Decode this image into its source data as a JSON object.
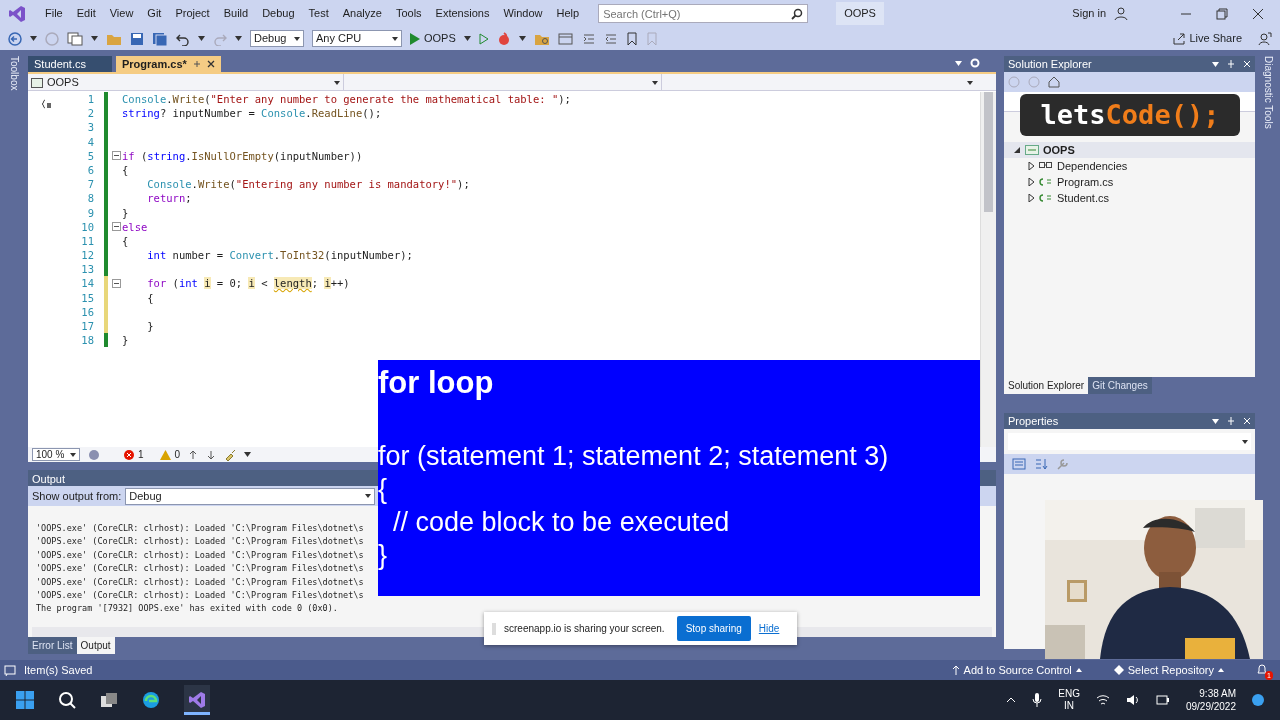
{
  "menu": [
    "File",
    "Edit",
    "View",
    "Git",
    "Project",
    "Build",
    "Debug",
    "Test",
    "Analyze",
    "Tools",
    "Extensions",
    "Window",
    "Help"
  ],
  "search": {
    "placeholder": "Search (Ctrl+Q)"
  },
  "solution_name": "OOPS",
  "sign_in": "Sign in",
  "toolbar": {
    "configuration": "Debug",
    "platform": "Any CPU",
    "run_target": "OOPS",
    "live_share": "Live Share"
  },
  "side_tabs": {
    "left": "Toolbox",
    "right": "Diagnostic Tools"
  },
  "editor": {
    "tabs": [
      {
        "label": "Student.cs",
        "selected": false
      },
      {
        "label": "Program.cs*",
        "selected": true
      }
    ],
    "project_dropdown": "OOPS",
    "lines": [
      {
        "number": "1",
        "modified": false,
        "foldable": false,
        "tokens": [
          {
            "text": "Console",
            "kind": "type"
          },
          {
            "text": ".",
            "kind": "plain"
          },
          {
            "text": "Write",
            "kind": "method"
          },
          {
            "text": "(",
            "kind": "plain"
          },
          {
            "text": "\"Enter any number to generate the mathematical table: \"",
            "kind": "string"
          },
          {
            "text": ");",
            "kind": "plain"
          }
        ]
      },
      {
        "number": "2",
        "modified": false,
        "foldable": false,
        "tokens": [
          {
            "text": "string",
            "kind": "keyword"
          },
          {
            "text": "? inputNumber = ",
            "kind": "plain"
          },
          {
            "text": "Console",
            "kind": "type"
          },
          {
            "text": ".",
            "kind": "plain"
          },
          {
            "text": "ReadLine",
            "kind": "method"
          },
          {
            "text": "();",
            "kind": "plain"
          }
        ]
      },
      {
        "number": "3",
        "modified": false,
        "foldable": false
      },
      {
        "number": "4",
        "modified": false,
        "foldable": false
      },
      {
        "number": "5",
        "modified": false,
        "foldable": true,
        "tokens": [
          {
            "text": "if",
            "kind": "control"
          },
          {
            "text": " (",
            "kind": "plain"
          },
          {
            "text": "string",
            "kind": "keyword"
          },
          {
            "text": ".",
            "kind": "plain"
          },
          {
            "text": "IsNullOrEmpty",
            "kind": "method"
          },
          {
            "text": "(inputNumber))",
            "kind": "plain"
          }
        ]
      },
      {
        "number": "6",
        "modified": false,
        "foldable": false,
        "tokens": [
          {
            "text": "{",
            "kind": "plain"
          }
        ]
      },
      {
        "number": "7",
        "modified": false,
        "foldable": false,
        "tokens": [
          {
            "text": "    Console",
            "kind": "type"
          },
          {
            "text": ".",
            "kind": "plain"
          },
          {
            "text": "Write",
            "kind": "method"
          },
          {
            "text": "(",
            "kind": "plain"
          },
          {
            "text": "\"Entering any number is mandatory!\"",
            "kind": "string"
          },
          {
            "text": ");",
            "kind": "plain"
          }
        ]
      },
      {
        "number": "8",
        "modified": false,
        "foldable": false,
        "tokens": [
          {
            "text": "    return",
            "kind": "control"
          },
          {
            "text": ";",
            "kind": "plain"
          }
        ]
      },
      {
        "number": "9",
        "modified": false,
        "foldable": false,
        "tokens": [
          {
            "text": "}",
            "kind": "plain"
          }
        ]
      },
      {
        "number": "10",
        "modified": false,
        "foldable": true,
        "tokens": [
          {
            "text": "else",
            "kind": "control"
          }
        ]
      },
      {
        "number": "11",
        "modified": false,
        "foldable": false,
        "tokens": [
          {
            "text": "{",
            "kind": "plain"
          }
        ]
      },
      {
        "number": "12",
        "modified": false,
        "foldable": false,
        "tokens": [
          {
            "text": "    int",
            "kind": "keyword"
          },
          {
            "text": " number = ",
            "kind": "plain"
          },
          {
            "text": "Convert",
            "kind": "type"
          },
          {
            "text": ".",
            "kind": "plain"
          },
          {
            "text": "ToInt32",
            "kind": "method"
          },
          {
            "text": "(inputNumber);",
            "kind": "plain"
          }
        ]
      },
      {
        "number": "13",
        "modified": false,
        "foldable": false
      },
      {
        "number": "14",
        "modified": true,
        "foldable": true,
        "tokens": [
          {
            "text": "    for",
            "kind": "control"
          },
          {
            "text": " (",
            "kind": "plain"
          },
          {
            "text": "int ",
            "kind": "keyword"
          },
          {
            "text": "i",
            "kind": "highlight"
          },
          {
            "text": " = 0; ",
            "kind": "plain"
          },
          {
            "text": "i",
            "kind": "highlight"
          },
          {
            "text": " < ",
            "kind": "plain"
          },
          {
            "text": "length",
            "kind": "error"
          },
          {
            "text": "; ",
            "kind": "plain"
          },
          {
            "text": "i",
            "kind": "highlight"
          },
          {
            "text": "++)",
            "kind": "plain"
          }
        ]
      },
      {
        "number": "15",
        "modified": true,
        "foldable": false,
        "tokens": [
          {
            "text": "    {",
            "kind": "plain"
          }
        ]
      },
      {
        "number": "16",
        "modified": true,
        "foldable": false
      },
      {
        "number": "17",
        "modified": true,
        "foldable": false,
        "tokens": [
          {
            "text": "    }",
            "kind": "plain"
          }
        ]
      },
      {
        "number": "18",
        "modified": false,
        "foldable": false,
        "tokens": [
          {
            "text": "}",
            "kind": "plain"
          }
        ]
      }
    ],
    "zoom": "100 %",
    "errors": "1",
    "warnings": "0"
  },
  "output": {
    "title": "Output",
    "source_label": "Show output from:",
    "source": "Debug",
    "lines": [
      "'OOPS.exe' (CoreCLR: clrhost): Loaded 'C:\\Program Files\\dotnet\\s",
      "'OOPS.exe' (CoreCLR: clrhost): Loaded 'C:\\Program Files\\dotnet\\s",
      "'OOPS.exe' (CoreCLR: clrhost): Loaded 'C:\\Program Files\\dotnet\\s",
      "'OOPS.exe' (CoreCLR: clrhost): Loaded 'C:\\Program Files\\dotnet\\s",
      "'OOPS.exe' (CoreCLR: clrhost): Loaded 'C:\\Program Files\\dotnet\\s",
      "'OOPS.exe' (CoreCLR: clrhost): Loaded 'C:\\Program Files\\dotnet\\s",
      "The program '[7932] OOPS.exe' has exited with code 0 (0x0)."
    ],
    "tabs": [
      {
        "label": "Error List",
        "selected": false
      },
      {
        "label": "Output",
        "selected": true
      }
    ]
  },
  "solution_explorer": {
    "title": "Solution Explorer",
    "tree": [
      {
        "label": "OOPS",
        "kind": "project",
        "expanded": true,
        "selected": true,
        "children": [
          {
            "label": "Dependencies",
            "kind": "dependencies",
            "expanded": false,
            "selected": false
          },
          {
            "label": "Program.cs",
            "kind": "file",
            "expanded": false,
            "selected": false
          },
          {
            "label": "Student.cs",
            "kind": "file",
            "expanded": false,
            "selected": false
          }
        ]
      }
    ],
    "tabs": [
      {
        "label": "Solution Explorer",
        "selected": true
      },
      {
        "label": "Git Changes",
        "selected": false
      }
    ]
  },
  "properties": {
    "title": "Properties"
  },
  "logo": {
    "first": "lets",
    "second": "Code();"
  },
  "slide": {
    "title": "for loop",
    "lines": [
      "for (statement 1; statement 2; statement 3)",
      "{",
      "  // code block to be executed",
      "}"
    ]
  },
  "share_bar": {
    "message": "screenapp.io is sharing your screen.",
    "stop": "Stop sharing",
    "hide": "Hide"
  },
  "status_bar": {
    "message": "Item(s) Saved",
    "source_control": "Add to Source Control",
    "repository": "Select Repository",
    "notifications": "1"
  },
  "taskbar": {
    "language": "ENG",
    "region": "IN",
    "time": "9:38 AM",
    "date": "09/29/2022"
  }
}
